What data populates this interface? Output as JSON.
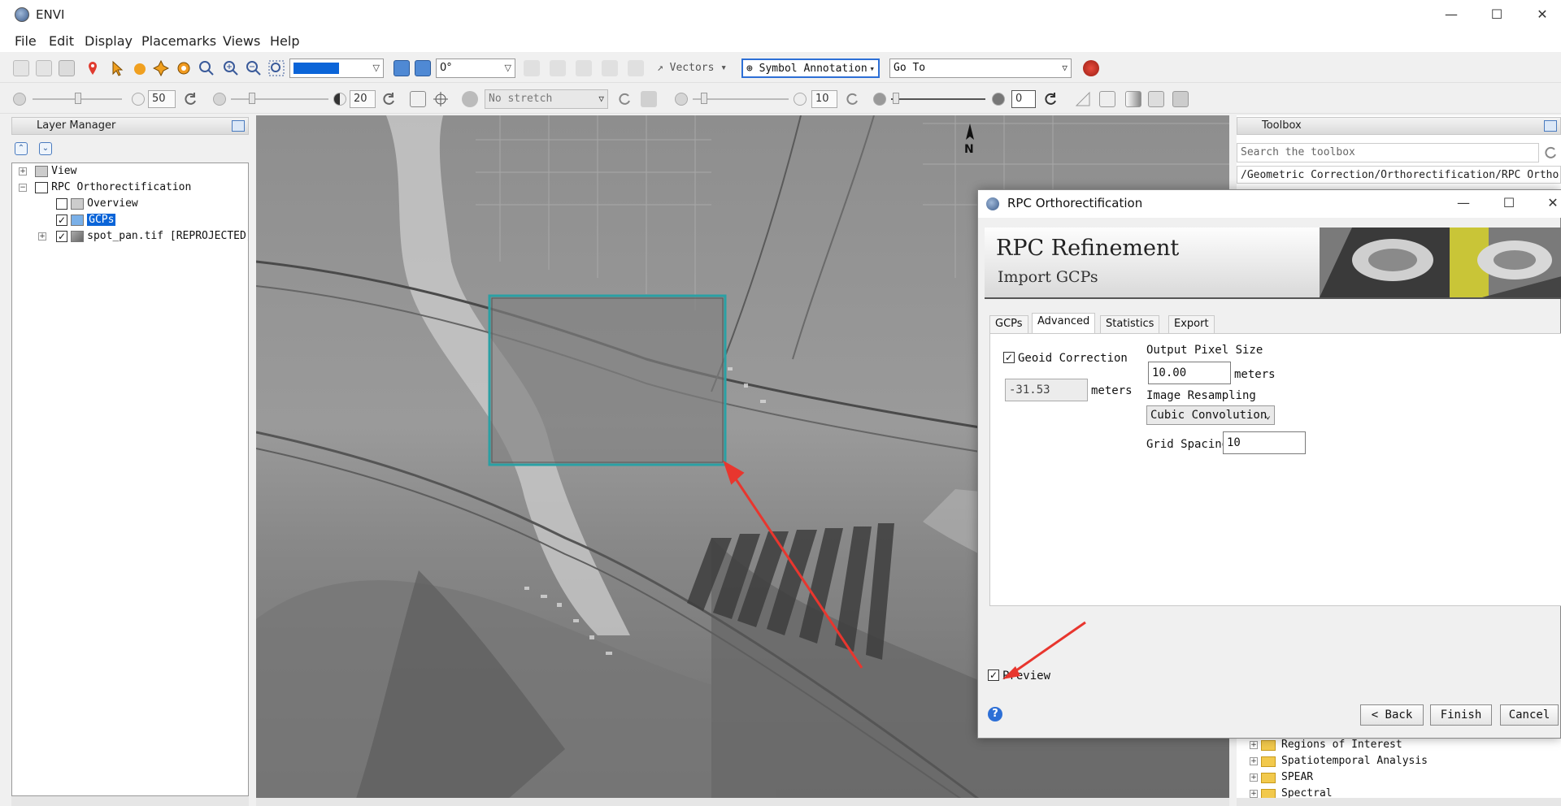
{
  "app": {
    "title": "ENVI"
  },
  "window_controls": {
    "minimize": "—",
    "maximize": "☐",
    "close": "✕"
  },
  "menu": [
    "File",
    "Edit",
    "Display",
    "Placemarks",
    "Views",
    "Help"
  ],
  "toolbar1": {
    "zoom_combo": "",
    "rotation": "0°",
    "vectors_label": "Vectors",
    "annotation_label": "Symbol Annotation",
    "goto_placeholder": "Go To"
  },
  "toolbar2": {
    "brightness": "50",
    "contrast": "20",
    "stretch": "No stretch",
    "sharpen": "10",
    "transparency": "0"
  },
  "layer_manager": {
    "title": "Layer Manager",
    "items": [
      {
        "label": "View"
      },
      {
        "label": "RPC Orthorectification"
      },
      {
        "label": "Overview"
      },
      {
        "label": "GCPs"
      },
      {
        "label": "spot_pan.tif [REPROJECTED]"
      }
    ]
  },
  "toolbox": {
    "title": "Toolbox",
    "search_placeholder": "Search the toolbox",
    "path": "/Geometric Correction/Orthorectification/RPC Orthore",
    "items": [
      {
        "label": "Regions of Interest"
      },
      {
        "label": "Spatiotemporal Analysis"
      },
      {
        "label": "SPEAR"
      },
      {
        "label": "Spectral"
      }
    ]
  },
  "dialog": {
    "title": "RPC Orthorectification",
    "banner_title": "RPC Refinement",
    "banner_subtitle": "Import GCPs",
    "tabs": [
      "GCPs",
      "Advanced",
      "Statistics",
      "Export"
    ],
    "active_tab": "Advanced",
    "geoid_label": "Geoid Correction",
    "geoid_checked": true,
    "geoid_value": "-31.53",
    "geoid_unit": "meters",
    "pixel_size_label": "Output Pixel Size",
    "pixel_size_value": "10.00",
    "pixel_size_unit": "meters",
    "resampling_label": "Image Resampling",
    "resampling_value": "Cubic Convolution",
    "grid_spacing_label": "Grid Spacing",
    "grid_spacing_value": "10",
    "preview_label": "Preview",
    "preview_checked": true,
    "buttons": {
      "back": "< Back",
      "finish": "Finish",
      "cancel": "Cancel"
    },
    "help": "?"
  },
  "colors": {
    "accent": "#2d6fd6",
    "preview_box": "#2aa0a4",
    "arrow": "#e8362e",
    "selection": "#0a64d8"
  }
}
